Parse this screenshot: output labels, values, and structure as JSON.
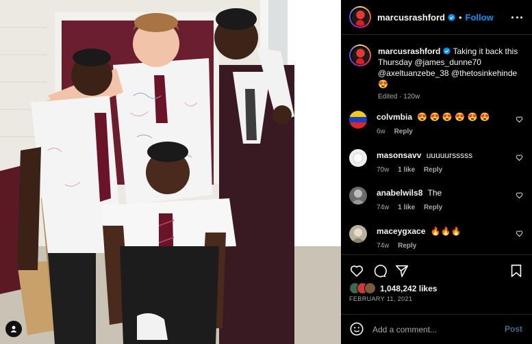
{
  "post": {
    "username": "marcusrashford",
    "follow_label": "Follow",
    "separator": "•",
    "caption": "Taking it back this Thursday @james_dunne70 @axeltuanzebe_38 @thetosinkehinde 😍",
    "edited_label": "Edited",
    "caption_time": "120w",
    "meta_separator": "·",
    "likes_count": "1,048,242",
    "likes_label": "likes",
    "date": "FEBRUARY 11, 2021"
  },
  "comments": [
    {
      "username": "colvmbia",
      "text": "😍 😍 😍 😍 😍 😍",
      "time": "6w",
      "likes": "",
      "reply_label": "Reply",
      "avatar_color": "#e3262b"
    },
    {
      "username": "masonsavv",
      "text": "uuuuursssss",
      "time": "70w",
      "likes": "1 like",
      "reply_label": "Reply",
      "avatar_color": "#f2f2f2"
    },
    {
      "username": "anabelwils8",
      "text": "The",
      "time": "74w",
      "likes": "1 like",
      "reply_label": "Reply",
      "avatar_color": "#8a8a8a"
    },
    {
      "username": "maceygxace",
      "text": "🔥🔥🔥",
      "time": "74w",
      "likes": "",
      "reply_label": "Reply",
      "avatar_color": "#b9b19a"
    }
  ],
  "add_comment": {
    "placeholder": "Add a comment...",
    "post_label": "Post"
  },
  "colors": {
    "background": "#000000",
    "link": "#0095f6",
    "secondary_text": "#a8a8a8",
    "post_disabled": "#4a6b8a"
  },
  "icons": {
    "header": [
      "verified-badge-icon",
      "more-options-icon"
    ],
    "actions": [
      "heart-icon",
      "comment-icon",
      "share-icon",
      "bookmark-icon"
    ],
    "photo": [
      "user-tag-icon"
    ],
    "composer": [
      "emoji-icon"
    ]
  }
}
